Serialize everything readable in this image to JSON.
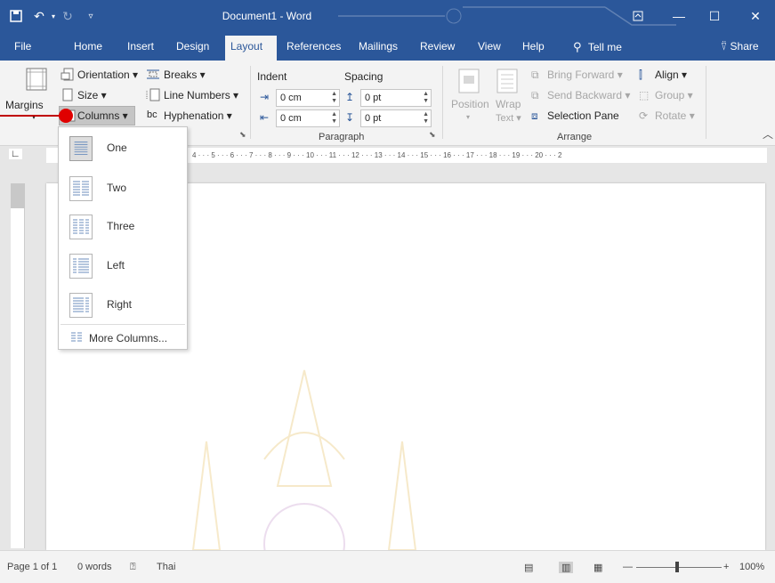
{
  "titlebar": {
    "doc_title": "Document1 - Word",
    "save_icon": "save-icon",
    "undo_icon": "undo-icon",
    "redo_icon": "redo-icon",
    "customize_icon": "chevron-down-icon",
    "ribbon_display_icon": "ribbon-display-icon",
    "minimize": "—",
    "maximize": "☐",
    "close": "✕"
  },
  "tabs": [
    {
      "label": "File"
    },
    {
      "label": "Home"
    },
    {
      "label": "Insert"
    },
    {
      "label": "Design"
    },
    {
      "label": "Layout"
    },
    {
      "label": "References"
    },
    {
      "label": "Mailings"
    },
    {
      "label": "Review"
    },
    {
      "label": "View"
    },
    {
      "label": "Help"
    }
  ],
  "tellme": {
    "label": "Tell me"
  },
  "share": {
    "label": "Share"
  },
  "page_setup": {
    "margins": "Margins",
    "orientation": "Orientation ▾",
    "size": "Size ▾",
    "columns": "Columns ▾",
    "breaks": "Breaks ▾",
    "line_numbers": "Line Numbers ▾",
    "hyphenation": "Hyphenation ▾"
  },
  "paragraph": {
    "group_label": "Paragraph",
    "indent_label": "Indent",
    "spacing_label": "Spacing",
    "indent_left": "0 cm",
    "indent_right": "0 cm",
    "spacing_before": "0 pt",
    "spacing_after": "0 pt"
  },
  "arrange": {
    "group_label": "Arrange",
    "position": "Position",
    "wrap_text_1": "Wrap",
    "wrap_text_2": "Text ▾",
    "bring_forward": "Bring Forward ▾",
    "send_backward": "Send Backward ▾",
    "selection_pane": "Selection Pane",
    "align": "Align ▾",
    "group": "Group ▾",
    "rotate": "Rotate ▾"
  },
  "ruler": {
    "marks": "4 · · · 5 · · · 6 · · · 7 · · · 8 · · · 9 · · · 10 · · · 11 · · · 12 · · · 13 · · · 14 · · · 15 · · · 16 · · · 17 · · · 18 · · · 19 · · · 20 · · · 2"
  },
  "columns_menu": {
    "items": [
      {
        "label": "One"
      },
      {
        "label": "Two"
      },
      {
        "label": "Three"
      },
      {
        "label": "Left"
      },
      {
        "label": "Right"
      }
    ],
    "more": "More Columns..."
  },
  "statusbar": {
    "page": "Page 1 of 1",
    "words": "0 words",
    "language": "Thai",
    "zoom": "100%"
  },
  "colors": {
    "accent": "#2b579a",
    "annotation": "#e00000"
  }
}
